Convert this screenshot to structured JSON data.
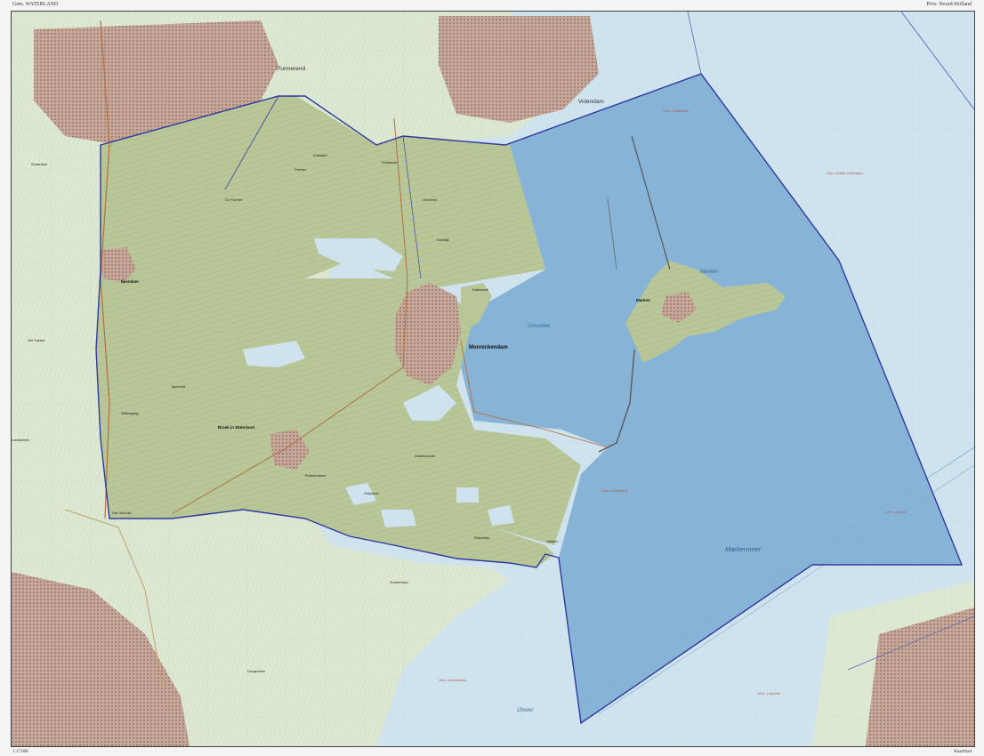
{
  "header": {
    "municipality": "Gem. WATERLAND",
    "province": "Prov. Noord-Holland"
  },
  "footer": {
    "scale_left": "1:17.000",
    "scale_right": "Kaartblad"
  },
  "labels": {
    "purmerend": "Purmerend",
    "volendam": "Volendam",
    "monnickendam": "Monnickendam",
    "broek": "Broek in Waterland",
    "ilpendam": "Ilpendam",
    "marken": "Marken",
    "gouwzee": "Gouwzee",
    "markermeer": "Markermeer",
    "ijmeer": "IJmeer",
    "de_purmer": "De Purmer",
    "uitdam": "Uitdam",
    "zuiderwoude": "Zuiderwoude",
    "watergang": "Watergang",
    "het_schouw": "Het Schouw",
    "katwoude": "Katwoude",
    "kolkdam": "Kolkdam",
    "purmer": "Purmer",
    "zuideinde": "Zuideinde",
    "overleek": "Overleek",
    "kwadijk": "Kwadijk",
    "ilperveld": "Ilperveld",
    "buitenhuizen": "Buitenhuizen",
    "holysloot": "Holysloot",
    "ransdorp": "Ransdorp",
    "zunderdorp": "Zunderdorp",
    "landsmeer": "Landsmeer",
    "schardam": "Schardam",
    "het_twiske": "Het Twiske",
    "durgerdam": "Durgerdam",
    "gem_waterland": "Gem. Waterland",
    "gem_waterland_2": "Gem. Waterland",
    "gem_almere": "Gem. Almere",
    "gem_lelystad": "Gem. Lelystad",
    "gem_edam_volendam": "Gem. Edam-Volendam",
    "gem_amsterdam": "Gem. Amsterdam"
  },
  "colors": {
    "lake": "#8ab6d6",
    "lake_shaded": "#6da2cc",
    "polder": "#b9c698",
    "surrounding_land": "#dde8d2",
    "urban": "#b99a8d",
    "boundary": "#2e3a9e",
    "water": "#cfe3ee"
  }
}
